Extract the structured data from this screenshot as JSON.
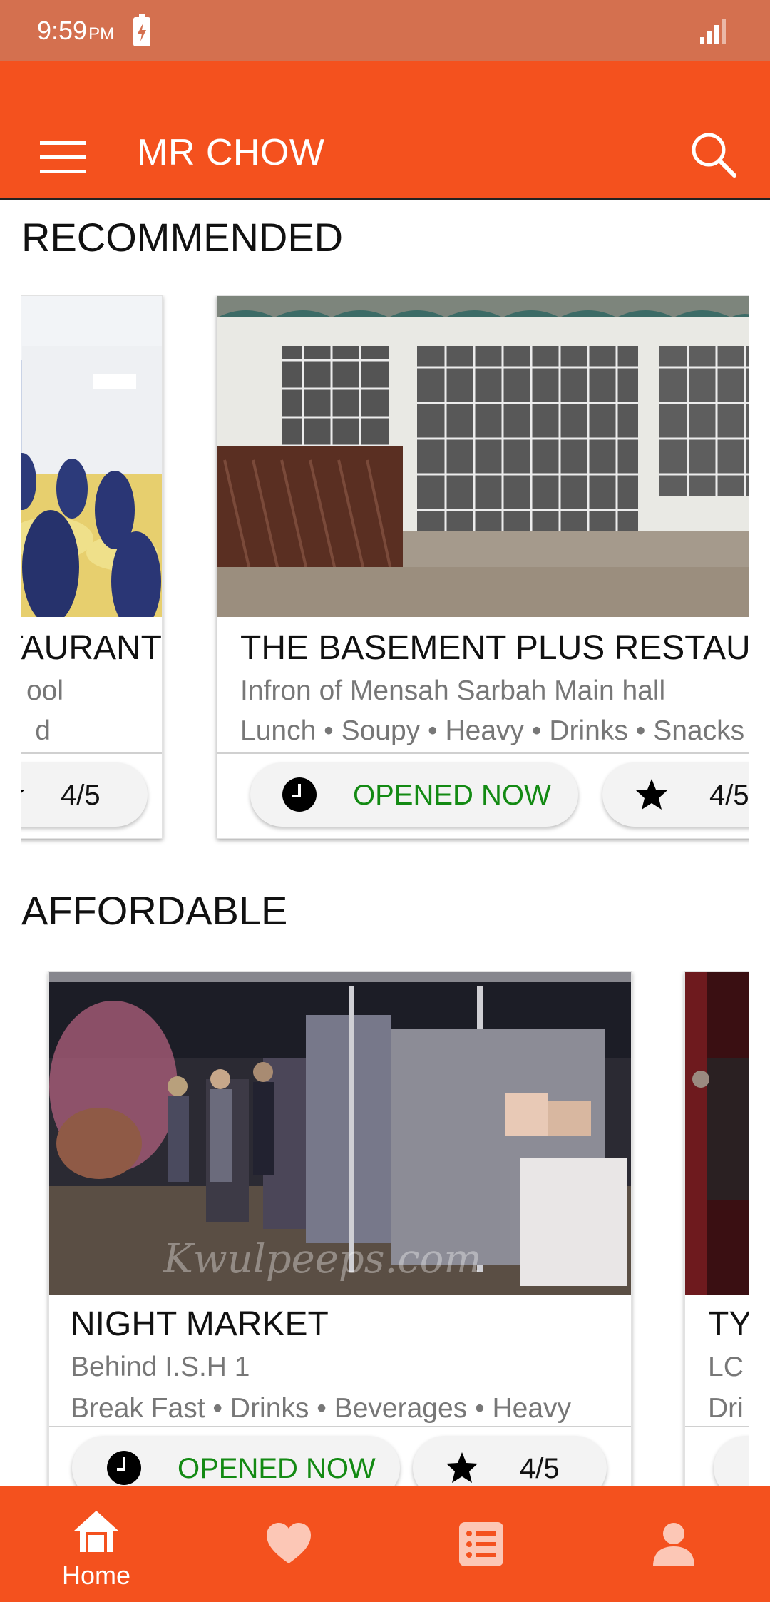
{
  "status_bar": {
    "time": "9:59",
    "ampm": "PM",
    "battery_icon": "battery-charging-icon",
    "signal_icon": "signal-icon"
  },
  "app_bar": {
    "title": "MR CHOW",
    "menu_icon": "hamburger-menu-icon",
    "search_icon": "search-icon",
    "color": "#f4511e"
  },
  "recommended": {
    "title": "RECOMMENDED",
    "cards": [
      {
        "name": "TAURANT",
        "location": "ool",
        "tags": "d",
        "rating": "4/5"
      },
      {
        "name": "THE BASEMENT PLUS RESTAUR",
        "location": "Infron of Mensah Sarbah Main hall",
        "tags": "Lunch • Soupy • Heavy • Drinks • Snacks",
        "status": "OPENED NOW",
        "rating": "4/5"
      }
    ]
  },
  "affordable": {
    "title": "AFFORDABLE",
    "cards": [
      {
        "name": "NIGHT MARKET",
        "location": "Behind I.S.H 1",
        "tags": "Break Fast • Drinks • Beverages • Heavy",
        "status": "OPENED NOW",
        "rating": "4/5",
        "watermark": "Kwulpeeps.com"
      },
      {
        "name": "TY",
        "location": "LC",
        "tags": "Dri"
      }
    ]
  },
  "bottom_nav": {
    "items": [
      {
        "label": "Home",
        "icon": "home-icon",
        "active": true
      },
      {
        "label": "",
        "icon": "heart-icon",
        "active": false
      },
      {
        "label": "",
        "icon": "list-icon",
        "active": false
      },
      {
        "label": "",
        "icon": "profile-icon",
        "active": false
      }
    ]
  },
  "colors": {
    "accent": "#f4511e",
    "status_bar": "#d4704f",
    "opened": "#138a13"
  }
}
